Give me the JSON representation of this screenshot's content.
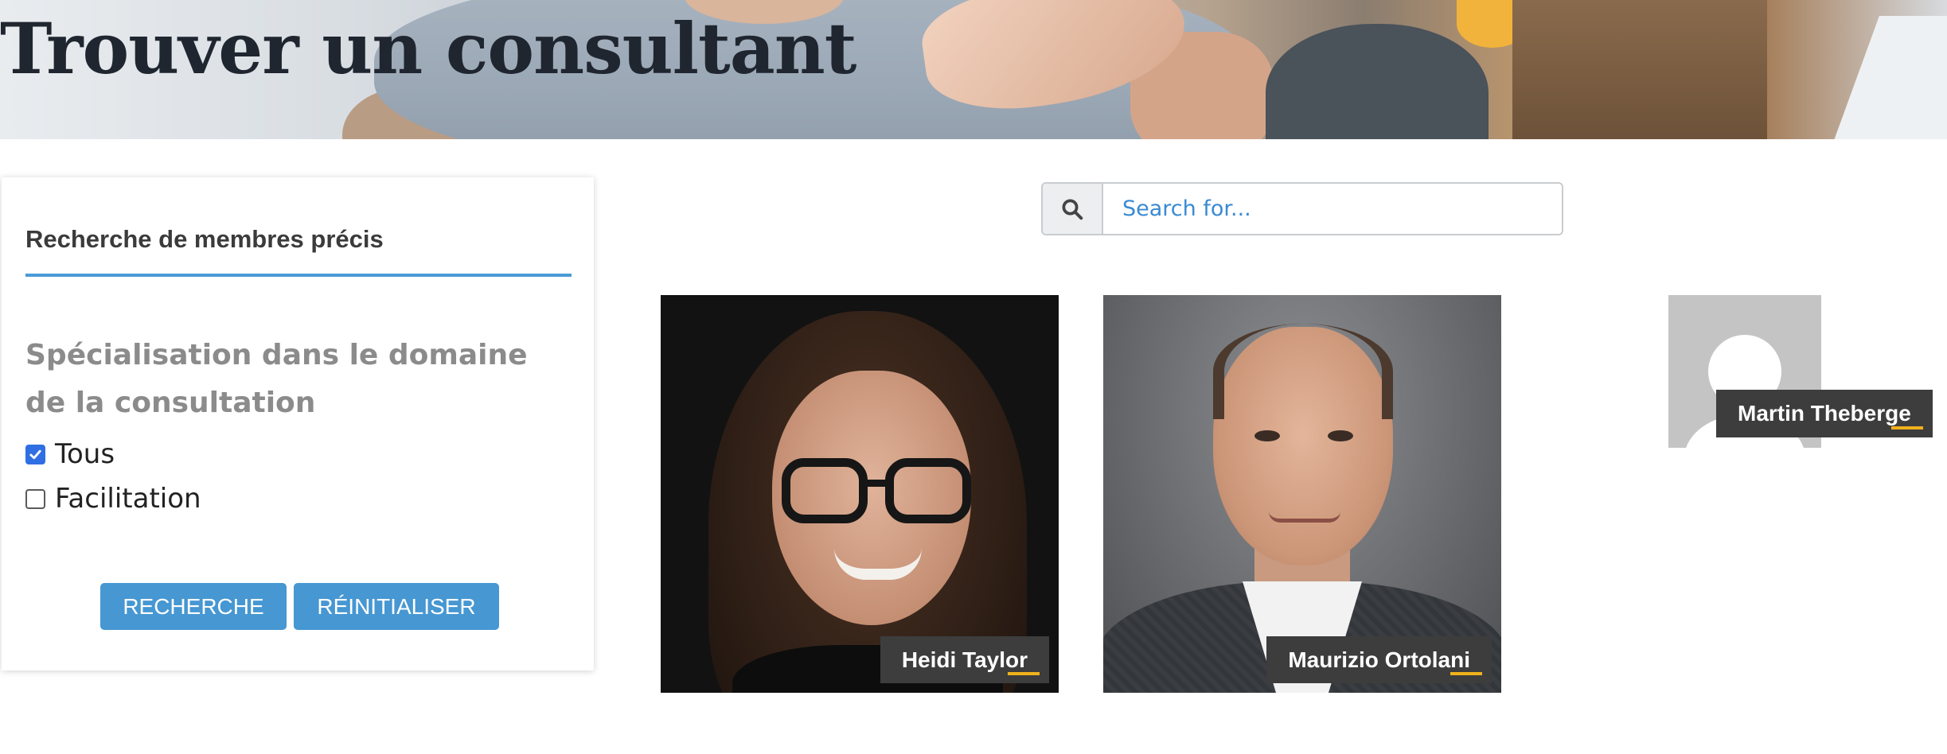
{
  "header": {
    "title": "Trouver un consultant"
  },
  "filter": {
    "title": "Recherche de membres précis",
    "specialisation_heading": "Spécialisation dans le domaine de la consultation",
    "options": [
      {
        "label": "Tous",
        "checked": true
      },
      {
        "label": "Facilitation",
        "checked": false
      }
    ],
    "search_button": "RECHERCHE",
    "reset_button": "RÉINITIALISER"
  },
  "search": {
    "placeholder": "Search for...",
    "icon": "search-icon"
  },
  "members": [
    {
      "name": "Heidi Taylor"
    },
    {
      "name": "Maurizio Ortolani"
    },
    {
      "name": "Martin Theberge"
    }
  ],
  "colors": {
    "accent_blue": "#4697d2",
    "label_bg": "#3d3d3d",
    "label_accent": "#f0b11b",
    "heading_grey": "#8b8b8b"
  }
}
